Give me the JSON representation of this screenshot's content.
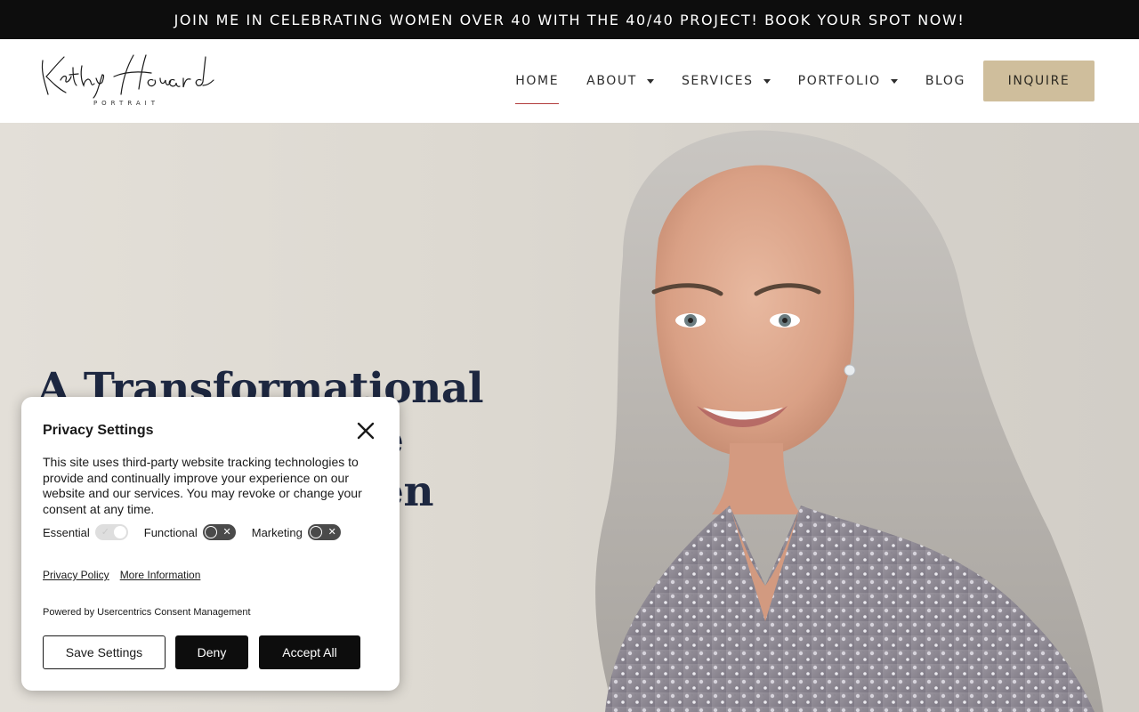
{
  "announcement": "JOIN ME IN CELEBRATING WOMEN OVER 40 WITH THE 40/40 PROJECT! BOOK YOUR SPOT NOW!",
  "logo": {
    "name": "Kathy Howard",
    "tagline": "PORTRAIT"
  },
  "nav": {
    "items": [
      {
        "label": "HOME",
        "active": true,
        "dropdown": false
      },
      {
        "label": "ABOUT",
        "dropdown": true
      },
      {
        "label": "SERVICES",
        "dropdown": true
      },
      {
        "label": "PORTFOLIO",
        "dropdown": true
      },
      {
        "label": "BLOG",
        "dropdown": false
      }
    ],
    "cta": "INQUIRE"
  },
  "hero": {
    "headline_lines": [
      "A Transformational",
      "e",
      "en"
    ]
  },
  "privacy": {
    "title": "Privacy Settings",
    "body": "This site uses third-party website tracking technologies to provide and continually improve your experience on our website and our services. You may revoke or change your consent at any time.",
    "toggles": [
      {
        "label": "Essential",
        "enabled": true
      },
      {
        "label": "Functional",
        "enabled": false
      },
      {
        "label": "Marketing",
        "enabled": false
      }
    ],
    "links": [
      "Privacy Policy",
      "More Information"
    ],
    "powered_by": "Powered by Usercentrics Consent Management",
    "buttons": {
      "save": "Save Settings",
      "deny": "Deny",
      "accept": "Accept All"
    }
  },
  "colors": {
    "accent": "#cfbe9c",
    "nav_active_underline": "#b23b3b",
    "headline": "#1d2740"
  }
}
